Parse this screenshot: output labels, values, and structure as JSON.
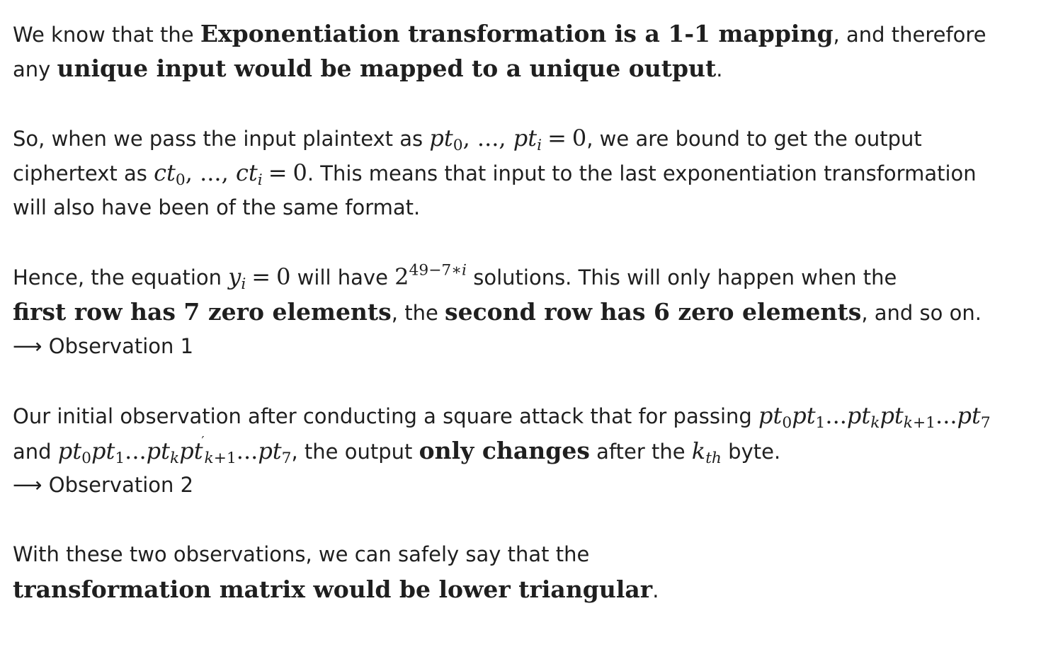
{
  "p1": {
    "t1": "We know that the ",
    "b1": "Exponentiation transformation is a 1-1 mapping",
    "t2": ", and therefore",
    "t3": "any ",
    "b2": "unique input would be mapped to a unique output",
    "t4": "."
  },
  "p2": {
    "t1": "So, when we pass the input plaintext as ",
    "t2": ", we are bound to get the output",
    "t3": "ciphertext as ",
    "t4": ". This means that input to the last exponentiation transformation",
    "t5": "will also have been of the same format."
  },
  "p3": {
    "t1": "Hence, the equation ",
    "t2": " will have ",
    "t3": " solutions. This will only happen when the",
    "b1": "first row has 7 zero elements",
    "t4": ", the ",
    "b2": "second row has 6 zero elements",
    "t5": ", and so on.",
    "arrow": "⟶",
    "obs": " Observation 1"
  },
  "p4": {
    "t1": "Our initial observation after conducting a square attack that for passing ",
    "t2": "and ",
    "t3": ", the output ",
    "b1": "only changes",
    "t4": " after the ",
    "t5": " byte.",
    "arrow": "⟶",
    "obs": " Observation 2"
  },
  "p5": {
    "t1": "With these two observations, we can safely say that the",
    "b1": "transformation matrix would be lower triangular",
    "t2": "."
  }
}
